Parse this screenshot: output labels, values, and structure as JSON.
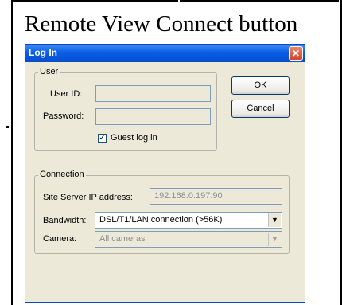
{
  "caption": "Remote View Connect button",
  "dialog": {
    "title": "Log In",
    "close_glyph": "✕",
    "user_group": {
      "legend": "User",
      "user_id_label": "User ID:",
      "user_id_value": "",
      "password_label": "Password:",
      "password_value": "",
      "guest_checkbox_checked": true,
      "guest_label": "Guest log in"
    },
    "buttons": {
      "ok": "OK",
      "cancel": "Cancel"
    },
    "connection_group": {
      "legend": "Connection",
      "ip_label": "Site Server IP address:",
      "ip_value": "192.168.0.197:90",
      "bandwidth_label": "Bandwidth:",
      "bandwidth_value": "DSL/T1/LAN connection (>56K)",
      "camera_label": "Camera:",
      "camera_value": "All cameras"
    }
  },
  "icons": {
    "dropdown": "▼",
    "check": "✓"
  },
  "colors": {
    "titlebar": "#0a5ee4",
    "dialog_bg": "#ece9d8",
    "close": "#d0452c"
  }
}
